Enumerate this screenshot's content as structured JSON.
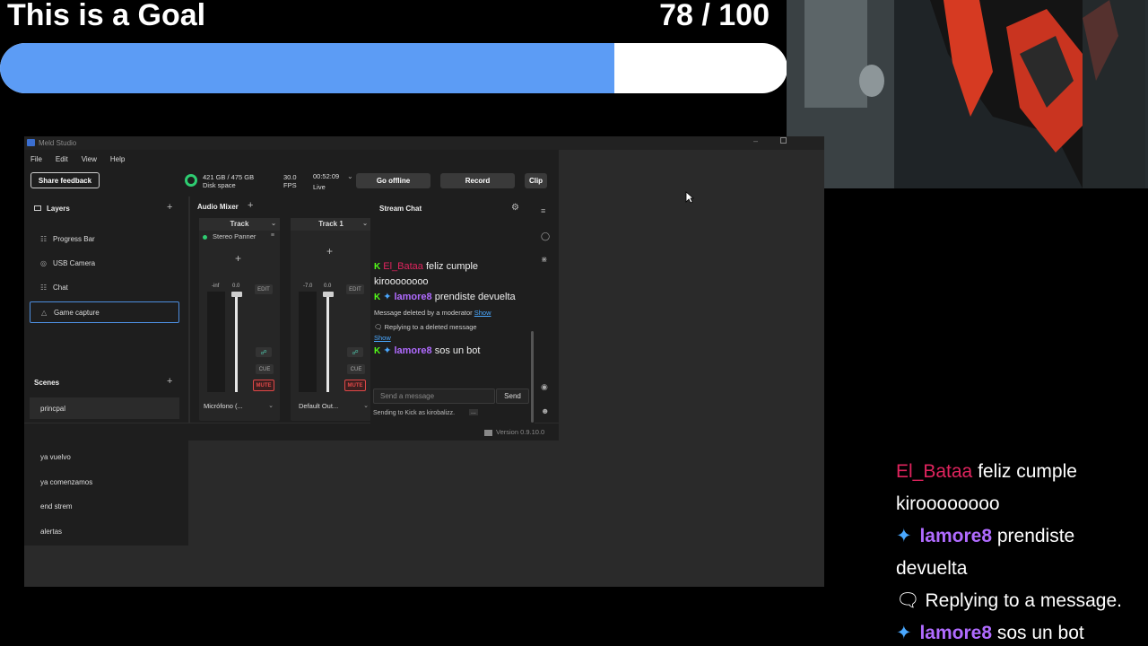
{
  "goal": {
    "title": "This is a Goal",
    "count": "78 / 100",
    "progress": 0.78,
    "fill_color": "#5c9cf5"
  },
  "window": {
    "title": "Meld Studio",
    "icon": "meld-app-icon"
  },
  "menu": [
    "File",
    "Edit",
    "View",
    "Help"
  ],
  "toolbar": {
    "feedback_label": "Share feedback",
    "disk_value": "421 GB / 475 GB",
    "disk_label": "Disk space",
    "fps_value": "30.0",
    "fps_label": "FPS",
    "time_value": "00:52:09",
    "live_label": "Live",
    "offline_label": "Go offline",
    "record_label": "Record",
    "clip_label": "Clip"
  },
  "layers": {
    "title": "Layers",
    "items": [
      {
        "label": "Progress Bar",
        "icon": "layer-icon"
      },
      {
        "label": "USB Camera",
        "icon": "camera-icon"
      },
      {
        "label": "Chat",
        "icon": "layer-icon"
      },
      {
        "label": "Game capture",
        "icon": "game-icon",
        "selected": true
      }
    ]
  },
  "scenes": {
    "title": "Scenes",
    "items": [
      "princpal",
      "ya vuelvo",
      "ya comenzamos",
      "end strem",
      "alertas"
    ]
  },
  "mixer": {
    "title": "Audio Mixer",
    "tracks": [
      {
        "name": "Track",
        "panner": "Stereo Panner",
        "meter_min": "-inf",
        "level": "0.0",
        "edit": "EDIT",
        "cue": "CUE",
        "mute": "MUTE",
        "device": "Micrófono (..."
      },
      {
        "name": "Track 1",
        "meter_min": "-7.0",
        "level": "0.0",
        "edit": "EDIT",
        "cue": "CUE",
        "mute": "MUTE",
        "device": "Default Out..."
      }
    ]
  },
  "stream_chat": {
    "title": "Stream Chat",
    "messages": [
      {
        "user": "El_Bataa",
        "text": "feliz cumple kiroooooooo"
      },
      {
        "user": "lamore8",
        "text": "prendiste devuelta"
      },
      {
        "system": "Message deleted by a moderator",
        "link": "Show"
      },
      {
        "system": "Replying to a deleted message",
        "link": "Show"
      },
      {
        "user": "lamore8",
        "text": "sos un bot"
      }
    ],
    "input_placeholder": "Send a message",
    "send_label": "Send",
    "sending_as": "Sending to Kick as kirobalizz.",
    "more": "..."
  },
  "version": "Version 0.9.10.0",
  "overlay_chat": {
    "lines": [
      {
        "user": "El_Bataa",
        "text": "feliz cumple"
      },
      {
        "text": "kiroooooooo"
      },
      {
        "user": "lamore8",
        "text": "prendiste"
      },
      {
        "text": "devuelta"
      },
      {
        "system": "Replying to a message."
      },
      {
        "user": "lamore8",
        "text": "sos un bot"
      }
    ]
  },
  "colors": {
    "accent": "#4d8dde",
    "kick_green": "#53fc18",
    "mute_red": "#e04848",
    "user_red": "#e0245e",
    "user_purple": "#b06bff"
  }
}
